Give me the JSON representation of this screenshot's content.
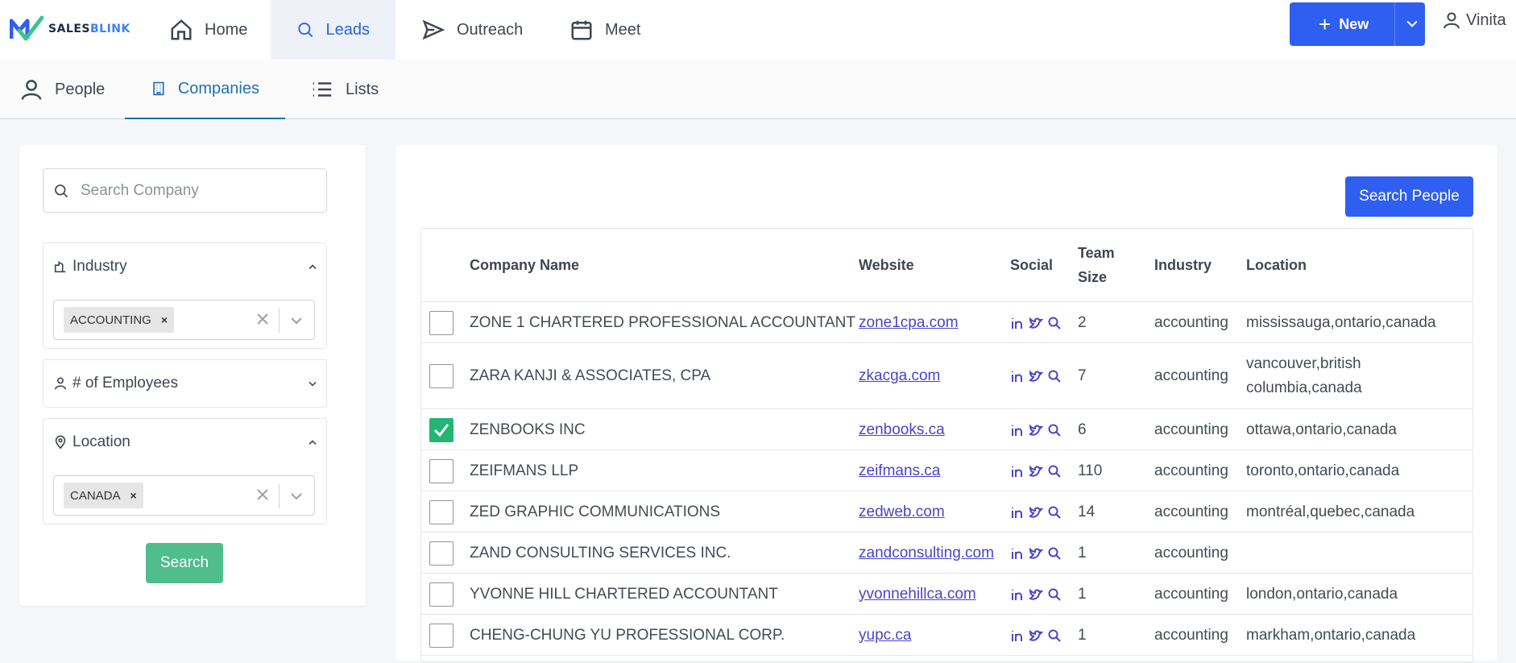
{
  "brand": {
    "name_part1": "SALES",
    "name_part2": "BLINK"
  },
  "topnav": {
    "items": [
      {
        "label": "Home",
        "icon": "home-icon"
      },
      {
        "label": "Leads",
        "icon": "search-icon",
        "active": true
      },
      {
        "label": "Outreach",
        "icon": "send-icon"
      },
      {
        "label": "Meet",
        "icon": "calendar-icon"
      }
    ],
    "new_button": {
      "label": "New",
      "plus": "+"
    },
    "user": {
      "name": "Vinita"
    }
  },
  "subnav": {
    "items": [
      {
        "label": "People",
        "icon": "person-icon"
      },
      {
        "label": "Companies",
        "icon": "building-icon",
        "active": true
      },
      {
        "label": "Lists",
        "icon": "list-icon"
      }
    ]
  },
  "filters": {
    "search_placeholder": "Search Company",
    "industry": {
      "label": "Industry",
      "chip": "ACCOUNTING",
      "chip_remove": "×"
    },
    "employees": {
      "label": "# of Employees"
    },
    "location": {
      "label": "Location",
      "chip": "CANADA",
      "chip_remove": "×"
    },
    "search_button": "Search"
  },
  "results": {
    "search_people_button": "Search People",
    "columns": {
      "company_name": "Company Name",
      "website": "Website",
      "social": "Social",
      "team_size_line1": "Team",
      "team_size_line2": "Size",
      "industry": "Industry",
      "location": "Location"
    },
    "rows": [
      {
        "name": "ZONE 1 CHARTERED PROFESSIONAL ACCOUNTANT",
        "website": "zone1cpa.com",
        "team": "2",
        "industry": "accounting",
        "loc1": "mississauga,ontario,canada",
        "loc2": "",
        "checked": false
      },
      {
        "name": "ZARA KANJI & ASSOCIATES, CPA",
        "website": "zkacga.com",
        "team": "7",
        "industry": "accounting",
        "loc1": "vancouver,british",
        "loc2": "columbia,canada",
        "checked": false
      },
      {
        "name": "ZENBOOKS INC",
        "website": "zenbooks.ca",
        "team": "6",
        "industry": "accounting",
        "loc1": "ottawa,ontario,canada",
        "loc2": "",
        "checked": true
      },
      {
        "name": "ZEIFMANS LLP",
        "website": "zeifmans.ca",
        "team": "110",
        "industry": "accounting",
        "loc1": "toronto,ontario,canada",
        "loc2": "",
        "checked": false
      },
      {
        "name": "ZED GRAPHIC COMMUNICATIONS",
        "website": "zedweb.com",
        "team": "14",
        "industry": "accounting",
        "loc1": "montréal,quebec,canada",
        "loc2": "",
        "checked": false
      },
      {
        "name": "ZAND CONSULTING SERVICES INC.",
        "website": "zandconsulting.com",
        "team": "1",
        "industry": "accounting",
        "loc1": "",
        "loc2": "",
        "checked": false
      },
      {
        "name": "YVONNE HILL CHARTERED ACCOUNTANT",
        "website": "yvonnehillca.com",
        "team": "1",
        "industry": "accounting",
        "loc1": "london,ontario,canada",
        "loc2": "",
        "checked": false
      },
      {
        "name": "CHENG-CHUNG YU PROFESSIONAL CORP.",
        "website": "yupc.ca",
        "team": "1",
        "industry": "accounting",
        "loc1": "markham,ontario,canada",
        "loc2": "",
        "checked": false
      }
    ]
  },
  "colors": {
    "primary": "#2f5ff0",
    "success": "#4fbd8c",
    "checkbox_checked": "#22b573",
    "link": "#4b44c8",
    "active_nav": "#2563eb"
  }
}
